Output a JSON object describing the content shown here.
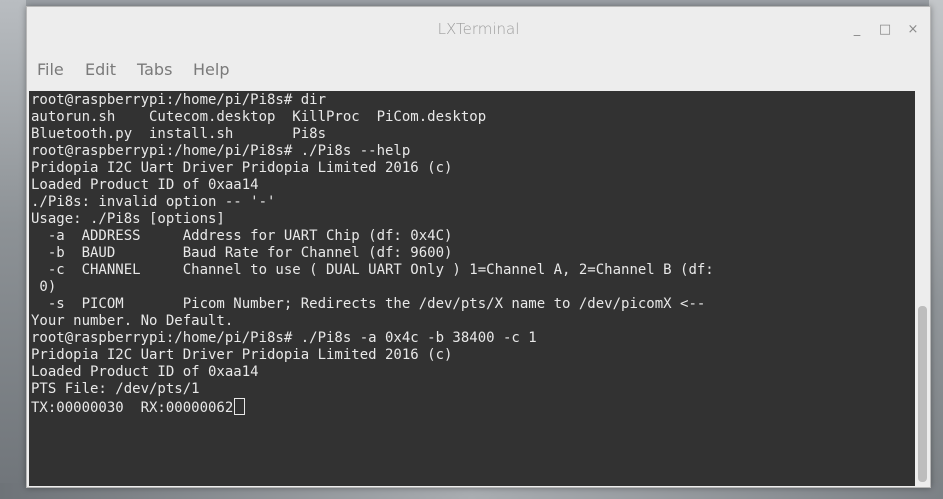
{
  "window": {
    "title": "LXTerminal",
    "controls": {
      "minimize": "_",
      "maximize": "□",
      "close": "×"
    }
  },
  "menu": {
    "file": "File",
    "edit": "Edit",
    "tabs": "Tabs",
    "help": "Help"
  },
  "terminal": {
    "lines": [
      "root@raspberrypi:/home/pi/Pi8s# dir",
      "autorun.sh    Cutecom.desktop  KillProc  PiCom.desktop",
      "Bluetooth.py  install.sh       Pi8s",
      "root@raspberrypi:/home/pi/Pi8s# ./Pi8s --help",
      "Pridopia I2C Uart Driver Pridopia Limited 2016 (c)",
      "Loaded Product ID of 0xaa14",
      "./Pi8s: invalid option -- '-'",
      "Usage: ./Pi8s [options]",
      "  -a  ADDRESS     Address for UART Chip (df: 0x4C)",
      "  -b  BAUD        Baud Rate for Channel (df: 9600)",
      "  -c  CHANNEL     Channel to use ( DUAL UART Only ) 1=Channel A, 2=Channel B (df:",
      " 0)",
      "  -s  PICOM       Picom Number; Redirects the /dev/pts/X name to /dev/picomX <--",
      "Your number. No Default.",
      "root@raspberrypi:/home/pi/Pi8s# ./Pi8s -a 0x4c -b 38400 -c 1",
      "Pridopia I2C Uart Driver Pridopia Limited 2016 (c)",
      "Loaded Product ID of 0xaa14",
      "PTS File: /dev/pts/1",
      "TX:00000030  RX:00000062"
    ]
  }
}
